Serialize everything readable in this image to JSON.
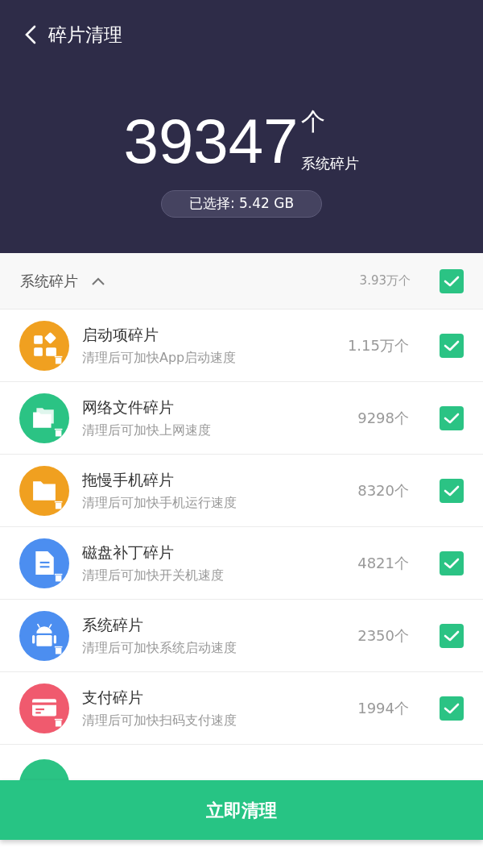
{
  "header": {
    "title": "碎片清理",
    "count": "39347",
    "unit": "个",
    "count_label": "系统碎片",
    "selected_summary": "已选择: 5.42 GB"
  },
  "group": {
    "title": "系统碎片",
    "expanded": true,
    "count": "3.93万个",
    "checked": true
  },
  "items": [
    {
      "kind": "apps",
      "color": "#f0a020",
      "title": "启动项碎片",
      "subtitle": "清理后可加快App启动速度",
      "count": "1.15万个",
      "checked": true
    },
    {
      "kind": "folders",
      "color": "#2bc384",
      "title": "网络文件碎片",
      "subtitle": "清理后可加快上网速度",
      "count": "9298个",
      "checked": true
    },
    {
      "kind": "folder",
      "color": "#f0a020",
      "title": "拖慢手机碎片",
      "subtitle": "清理后可加快手机运行速度",
      "count": "8320个",
      "checked": true
    },
    {
      "kind": "document",
      "color": "#4c8ef0",
      "title": "磁盘补丁碎片",
      "subtitle": "清理后可加快开关机速度",
      "count": "4821个",
      "checked": true
    },
    {
      "kind": "android",
      "color": "#4c8ef0",
      "title": "系统碎片",
      "subtitle": "清理后可加快系统启动速度",
      "count": "2350个",
      "checked": true
    },
    {
      "kind": "card",
      "color": "#f05a6e",
      "title": "支付碎片",
      "subtitle": "清理后可加快扫码支付速度",
      "count": "1994个",
      "checked": true
    }
  ],
  "partial_item": {
    "color": "#2bc384"
  },
  "clean_button": "立即清理"
}
